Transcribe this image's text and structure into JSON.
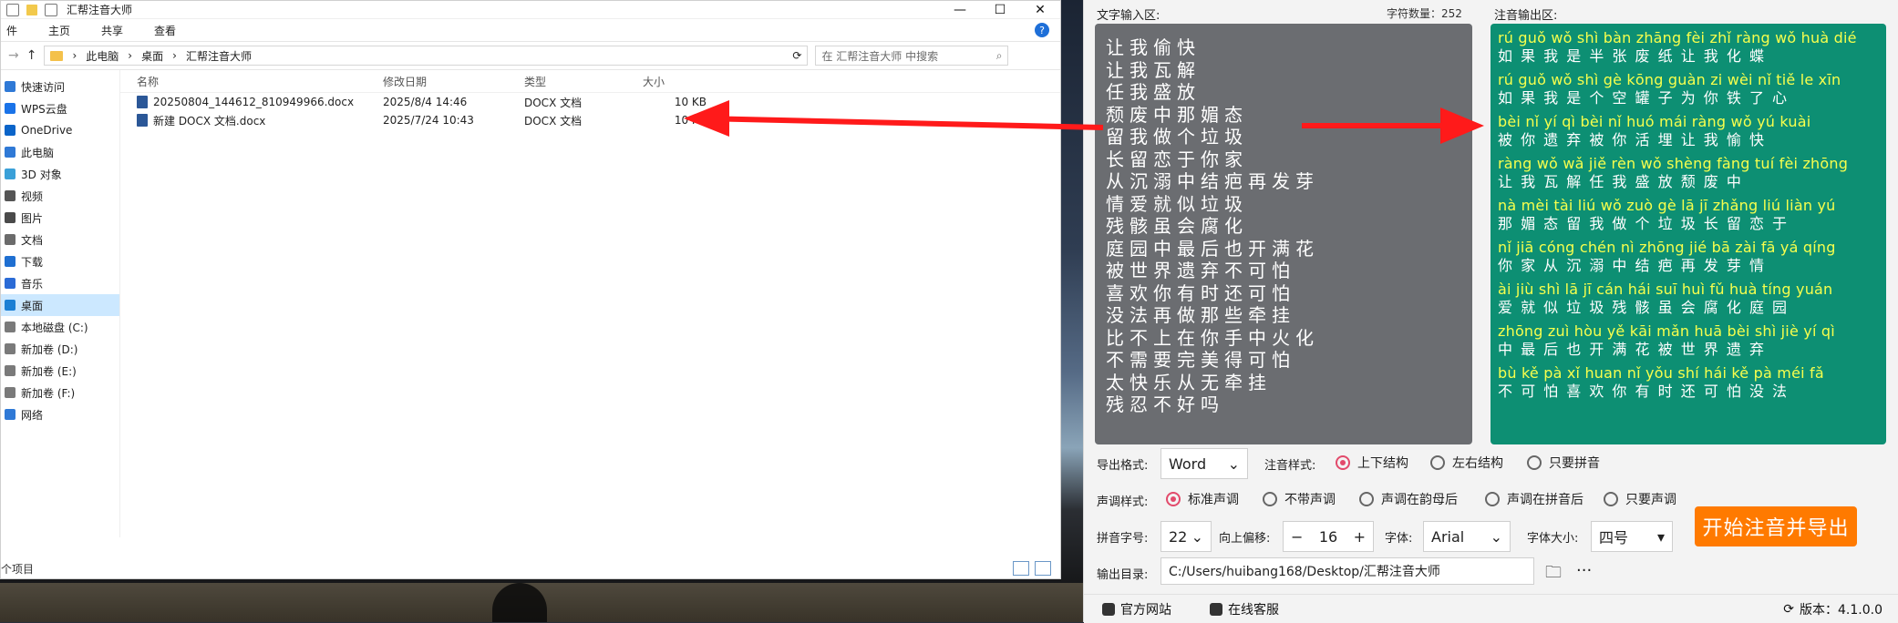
{
  "explorer": {
    "title": "汇帮注音大师",
    "window_controls": [
      "—",
      "☐",
      "✕"
    ],
    "ribbon": {
      "tabs": [
        "件",
        "主页",
        "共享",
        "查看"
      ]
    },
    "address": {
      "breadcrumb": [
        "此电脑",
        "桌面",
        "汇帮注音大师"
      ],
      "search_placeholder": "在 汇帮注音大师 中搜索"
    },
    "sidebar": {
      "items": [
        {
          "label": "快速访问"
        },
        {
          "label": "WPS云盘"
        },
        {
          "label": "OneDrive"
        },
        {
          "label": "此电脑"
        },
        {
          "label": "3D 对象"
        },
        {
          "label": "视频"
        },
        {
          "label": "图片"
        },
        {
          "label": "文档"
        },
        {
          "label": "下载"
        },
        {
          "label": "音乐"
        },
        {
          "label": "桌面"
        },
        {
          "label": "本地磁盘 (C:)"
        },
        {
          "label": "新加卷 (D:)"
        },
        {
          "label": "新加卷 (E:)"
        },
        {
          "label": "新加卷 (F:)"
        },
        {
          "label": "网络"
        }
      ]
    },
    "columns": [
      "名称",
      "修改日期",
      "类型",
      "大小"
    ],
    "files": [
      {
        "name": "20250804_144612_810949966.docx",
        "date": "2025/8/4 14:46",
        "type": "DOCX 文档",
        "size": "10 KB"
      },
      {
        "name": "新建 DOCX 文档.docx",
        "date": "2025/7/24 10:43",
        "type": "DOCX 文档",
        "size": "10 KB"
      }
    ],
    "status": "个项目"
  },
  "app": {
    "input_label": "文字输入区:",
    "char_count": "字符数量：252",
    "output_label": "注音输出区:",
    "input_lines": [
      "让我偷快",
      "让我瓦解",
      "任我盛放",
      "颓废中那媚态",
      "留我做个垃圾",
      "长留恋于你家",
      "从沉溺中结疤再发芽",
      "情爱就似垃圾",
      "残骸虽会腐化",
      "庭园中最后也开满花",
      "被世界遗弃不可怕",
      "喜欢你有时还可怕",
      "没法再做那些牵挂",
      "比不上在你手中火化",
      "不需要完美得可怕",
      "太快乐从无牵挂",
      "残忍不好吗"
    ],
    "output_pairs": [
      {
        "py": "rú guǒ wǒ shì bàn zhāng fèi zhǐ ràng wǒ huà dié",
        "hz": "如 果 我 是 半  张  废 纸 让 我 化 蝶"
      },
      {
        "py": "rú guǒ wǒ shì gè kōng guàn zi wèi nǐ tiě le xīn",
        "hz": "如 果 我 是 个  空  罐 子 为 你 铁 了 心"
      },
      {
        "py": "bèi nǐ yí qì bèi nǐ huó mái ràng wǒ yú kuài",
        "hz": "被 你 遗 弃 被 你 活  埋  让  我 愉  快"
      },
      {
        "py": "ràng wǒ wǎ jiě rèn wǒ shèng fàng tuí fèi zhōng",
        "hz": "让 我 瓦 解 任 我  盛   放  颓 废  中"
      },
      {
        "py": "nà mèi tài liú wǒ zuò gè lā jī zhǎng liú liàn yú",
        "hz": "那 媚 态 留 我 做 个 垃 圾  长  留 恋 于"
      },
      {
        "py": "nǐ jiā cóng chén nì zhōng jié bā zài fā yá qíng",
        "hz": "你 家 从  沉  溺  中  结 疤 再 发 芽 情"
      },
      {
        "py": "ài jiù shì lā jī cán hái suī huì fǔ huà tíng yuán",
        "hz": "爱 就 似 垃 圾 残 骸 虽 会 腐 化  庭  园"
      },
      {
        "py": "zhōng zuì hòu yě kāi mǎn huā bèi shì jiè yí qì",
        "hz": "中  最  后 也 开  满  花  被 世 界 遗 弃"
      },
      {
        "py": "bù kě pà xǐ huan nǐ yǒu shí hái kě pà méi fǎ",
        "hz": "不 可 怕 喜  欢  你 有 时 还 可 怕 没 法"
      }
    ],
    "controls": {
      "export_format_label": "导出格式:",
      "export_format_value": "Word",
      "zhuyin_style_label": "注音样式:",
      "zhuyin_options": [
        "上下结构",
        "左右结构",
        "只要拼音"
      ],
      "tone_style_label": "声调样式:",
      "tone_options": [
        "标准声调",
        "不带声调",
        "声调在韵母后",
        "声调在拼音后",
        "只要声调"
      ],
      "pinyin_size_label": "拼音字号:",
      "pinyin_size_value": "22",
      "offset_label": "向上偏移:",
      "offset_value": "16",
      "font_label": "字体:",
      "font_value": "Arial",
      "font_size_label": "字体大小:",
      "font_size_value": "四号",
      "start_button": "开始注音并导出",
      "output_dir_label": "输出目录:",
      "output_dir_value": "C:/Users/huibang168/Desktop/汇帮注音大师",
      "more": "···",
      "minus": "−",
      "plus": "+"
    },
    "bottom": {
      "site": "官方网站",
      "service": "在线客服",
      "version": "版本：4.1.0.0"
    }
  },
  "colors": {
    "output_bg": "#0d8f73",
    "input_bg": "#6b6d71",
    "accent_orange": "#ff7a00",
    "radio_accent": "#e24a6b",
    "arrow_red": "#ff1a1a"
  }
}
